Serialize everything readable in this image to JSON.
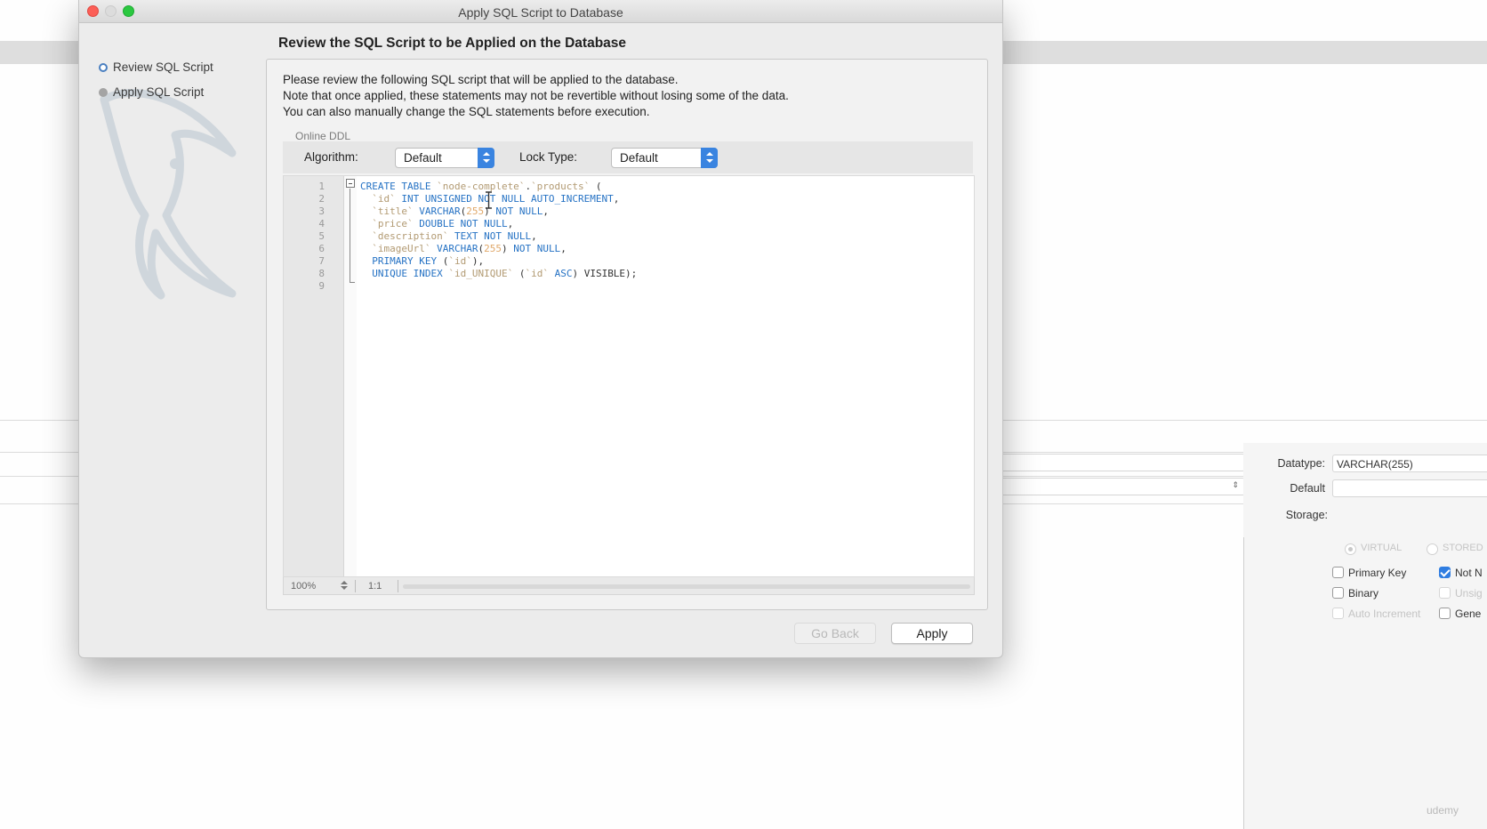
{
  "dialog": {
    "title": "Apply SQL Script to Database",
    "heading": "Review the SQL Script to be Applied on the Database",
    "steps": [
      {
        "label": "Review SQL Script",
        "state": "active"
      },
      {
        "label": "Apply SQL Script",
        "state": "pending"
      }
    ],
    "description": [
      "Please review the following SQL script that will be applied to the database.",
      "Note that once applied, these statements may not be revertible without losing some of the data.",
      "You can also manually change the SQL statements before execution."
    ],
    "online_ddl": {
      "legend": "Online DDL",
      "algorithm_label": "Algorithm:",
      "algorithm_value": "Default",
      "lock_type_label": "Lock Type:",
      "lock_type_value": "Default"
    },
    "editor": {
      "line_numbers": [
        "1",
        "2",
        "3",
        "4",
        "5",
        "6",
        "7",
        "8",
        "9"
      ],
      "lines": [
        [
          {
            "t": "CREATE TABLE ",
            "c": "kw"
          },
          {
            "t": "`node-complete`",
            "c": "id"
          },
          {
            "t": ".",
            "c": "pun"
          },
          {
            "t": "`products`",
            "c": "id"
          },
          {
            "t": " (",
            "c": "pun"
          }
        ],
        [
          {
            "t": "  `id` ",
            "c": "id"
          },
          {
            "t": "INT UNSIGNED NOT NULL AUTO_INCREMENT",
            "c": "kw"
          },
          {
            "t": ",",
            "c": "pun"
          }
        ],
        [
          {
            "t": "  `title` ",
            "c": "id"
          },
          {
            "t": "VARCHAR",
            "c": "kw"
          },
          {
            "t": "(",
            "c": "pun"
          },
          {
            "t": "255",
            "c": "num"
          },
          {
            "t": ") ",
            "c": "pun"
          },
          {
            "t": "NOT NULL",
            "c": "kw"
          },
          {
            "t": ",",
            "c": "pun"
          }
        ],
        [
          {
            "t": "  `price` ",
            "c": "id"
          },
          {
            "t": "DOUBLE NOT NULL",
            "c": "kw"
          },
          {
            "t": ",",
            "c": "pun"
          }
        ],
        [
          {
            "t": "  `description` ",
            "c": "id"
          },
          {
            "t": "TEXT NOT NULL",
            "c": "kw"
          },
          {
            "t": ",",
            "c": "pun"
          }
        ],
        [
          {
            "t": "  `imageUrl` ",
            "c": "id"
          },
          {
            "t": "VARCHAR",
            "c": "kw"
          },
          {
            "t": "(",
            "c": "pun"
          },
          {
            "t": "255",
            "c": "num"
          },
          {
            "t": ") ",
            "c": "pun"
          },
          {
            "t": "NOT NULL",
            "c": "kw"
          },
          {
            "t": ",",
            "c": "pun"
          }
        ],
        [
          {
            "t": "  PRIMARY KEY ",
            "c": "kw"
          },
          {
            "t": "(",
            "c": "pun"
          },
          {
            "t": "`id`",
            "c": "id"
          },
          {
            "t": "),",
            "c": "pun"
          }
        ],
        [
          {
            "t": "  UNIQUE INDEX ",
            "c": "kw"
          },
          {
            "t": "`id_UNIQUE`",
            "c": "id"
          },
          {
            "t": " (",
            "c": "pun"
          },
          {
            "t": "`id`",
            "c": "id"
          },
          {
            "t": " ASC",
            "c": "kw"
          },
          {
            "t": ") VISIBLE);",
            "c": "pun"
          }
        ],
        []
      ],
      "zoom": "100%",
      "position": "1:1"
    },
    "buttons": {
      "back": "Go Back",
      "apply": "Apply"
    }
  },
  "background": {
    "datatype_label": "Datatype:",
    "datatype_value": "VARCHAR(255)",
    "default_label": "Default",
    "storage_label": "Storage:",
    "storage_options": [
      "VIRTUAL",
      "STORED"
    ],
    "checkboxes": [
      {
        "label": "Primary Key",
        "checked": false,
        "enabled": true
      },
      {
        "label": "Not N",
        "checked": true,
        "enabled": true
      },
      {
        "label": "Binary",
        "checked": false,
        "enabled": true
      },
      {
        "label": "Unsig",
        "checked": false,
        "enabled": false
      },
      {
        "label": "Auto Increment",
        "checked": false,
        "enabled": false
      },
      {
        "label": "Gene",
        "checked": false,
        "enabled": true
      }
    ],
    "watermark": "udemy"
  },
  "colors": {
    "keyword": "#2572c4",
    "identifier": "#b29a72",
    "number": "#e0a86a",
    "accent": "#3a84e0",
    "close": "#fc5f57",
    "maximize": "#2bc840"
  }
}
